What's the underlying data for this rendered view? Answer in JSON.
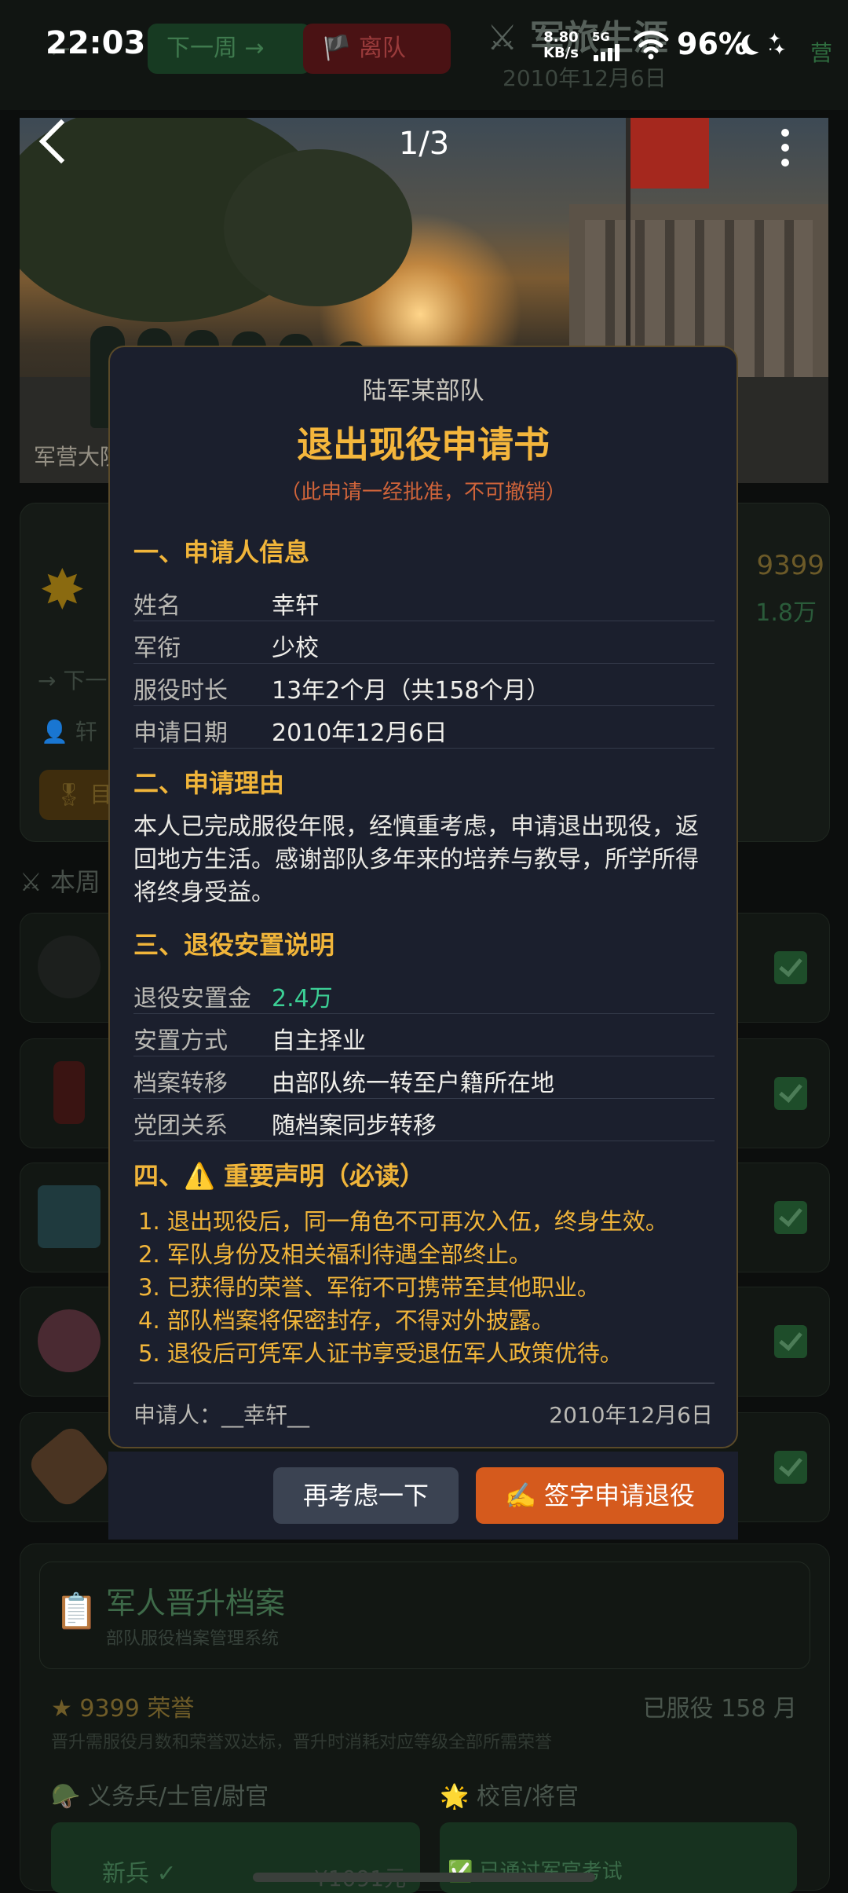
{
  "status_bar": {
    "time": "22:03",
    "net_speed_value": "8.80",
    "net_speed_unit": "KB/s",
    "network": "5G",
    "battery": "96%"
  },
  "background": {
    "header": {
      "next_week_label": "下一周 →",
      "leave_label": "🏴 离队",
      "title": "⚔ 军旅生涯",
      "date": "2010年12月6日",
      "tag": "营"
    },
    "hero": {
      "counter": "1/3",
      "caption": "军营大院"
    },
    "status_card": {
      "honor": "9399",
      "money": "1.8万",
      "next_text": "→ 下一",
      "user_text": "👤 轩",
      "medal_text": "🎖 目"
    },
    "weekly_label": "⚔ 本周",
    "archive": {
      "title": "军人晋升档案",
      "subtitle": "部队服役档案管理系统",
      "honor_text": "★ 9399 荣誉",
      "served_text": "已服役 158 月",
      "note": "晋升需服役月数和荣誉双达标，晋升时消耗对应等级全部所需荣誉",
      "col_left": "🪖 义务兵/士官/尉官",
      "col_right": "🌟 校官/将官",
      "rank_left": "新兵 ✓",
      "price_left": "¥1091元",
      "pass_right": "✅ 已通过军官考试"
    }
  },
  "modal": {
    "org": "陆军某部队",
    "title": "退出现役申请书",
    "warning": "（此申请一经批准，不可撤销）",
    "section1": "一、申请人信息",
    "applicant_info": [
      {
        "label": "姓名",
        "value": "幸轩"
      },
      {
        "label": "军衔",
        "value": "少校"
      },
      {
        "label": "服役时长",
        "value": "13年2个月（共158个月）"
      },
      {
        "label": "申请日期",
        "value": "2010年12月6日"
      }
    ],
    "section2": "二、申请理由",
    "reason": "本人已完成服役年限，经慎重考虑，申请退出现役，返回地方生活。感谢部队多年来的培养与教导，所学所得将终身受益。",
    "section3": "三、退役安置说明",
    "settlement": [
      {
        "label": "退役安置金",
        "value": "2.4万"
      },
      {
        "label": "安置方式",
        "value": "自主择业"
      },
      {
        "label": "档案转移",
        "value": "由部队统一转至户籍所在地"
      },
      {
        "label": "党团关系",
        "value": "随档案同步转移"
      }
    ],
    "section4": "四、⚠️ 重要声明（必读）",
    "declarations": [
      "1. 退出现役后，同一角色不可再次入伍，终身生效。",
      "2. 军队身份及相关福利待遇全部终止。",
      "3. 已获得的荣誉、军衔不可携带至其他职业。",
      "4. 部队档案将保密封存，不得对外披露。",
      "5. 退役后可凭军人证书享受退伍军人政策优待。"
    ],
    "signature": "申请人：__幸轩__",
    "signature_date": "2010年12月6日",
    "cancel_label": "再考虑一下",
    "confirm_label": "✍️ 签字申请退役"
  }
}
